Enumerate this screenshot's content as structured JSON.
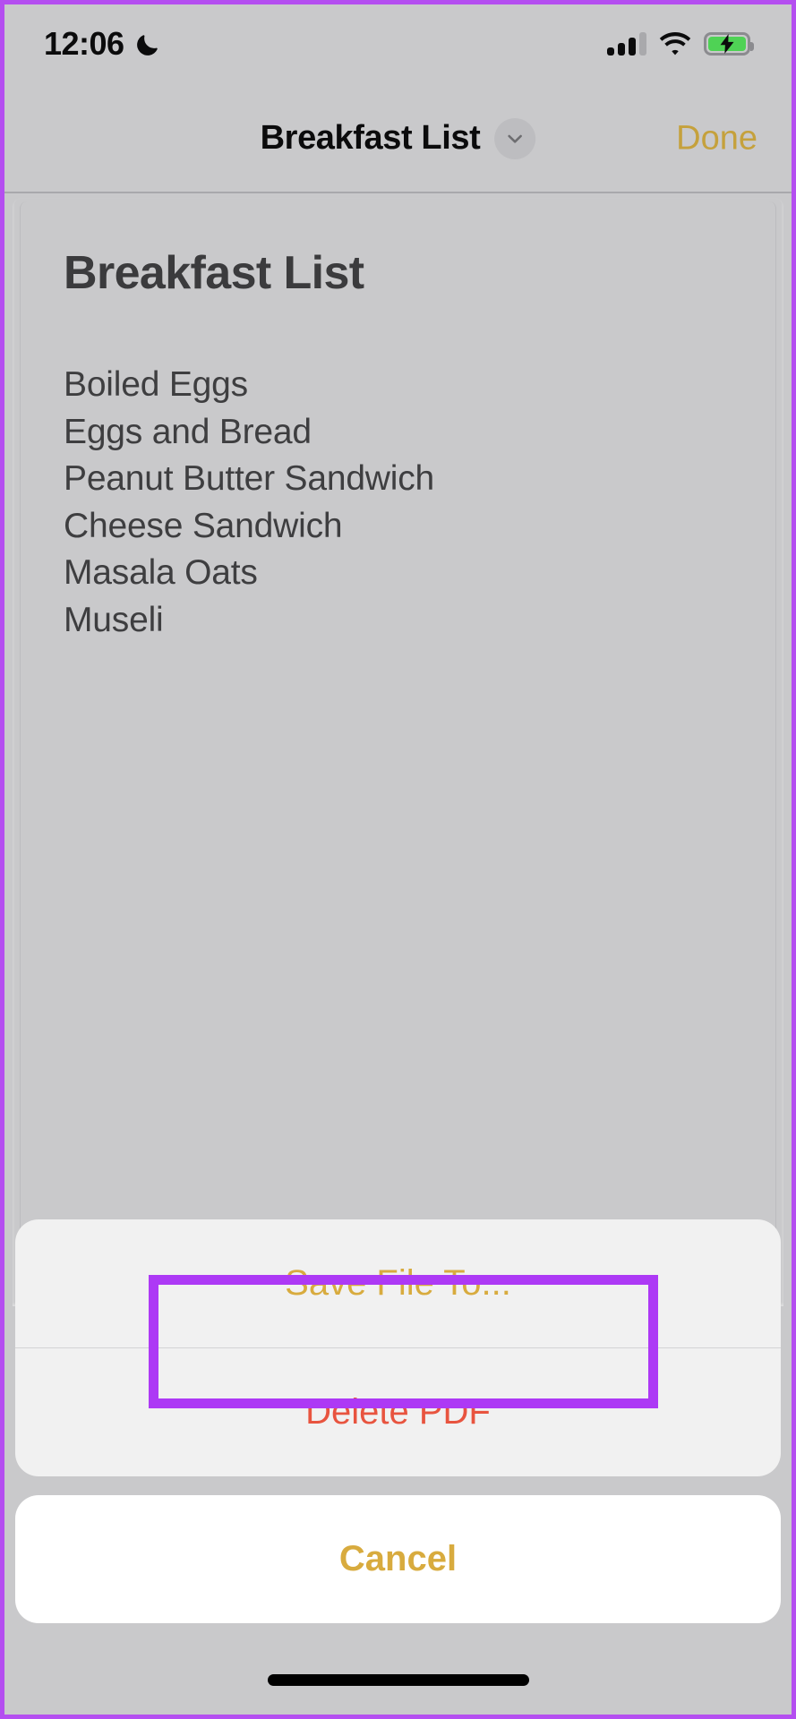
{
  "colors": {
    "accent_amber": "#d8ab3e",
    "destructive_red": "#e8543f",
    "highlight_purple": "#ad39f5",
    "screen_background": "#c9c9cb",
    "battery_green": "#4fd255"
  },
  "status_bar": {
    "time": "12:06",
    "moon_icon": "crescent-moon-icon",
    "signal_icon": "cellular-signal-icon",
    "signal_bars_filled": 3,
    "signal_bars_total": 4,
    "wifi_icon": "wifi-icon",
    "battery_icon": "battery-charging-icon",
    "battery_charging": true
  },
  "nav_bar": {
    "title": "Breakfast List",
    "chevron_icon": "chevron-down-icon",
    "done_label": "Done"
  },
  "document": {
    "heading": "Breakfast List",
    "items": [
      "Boiled Eggs",
      "Eggs and Bread",
      "Peanut Butter Sandwich",
      "Cheese Sandwich",
      "Masala Oats",
      "Museli"
    ]
  },
  "action_sheet": {
    "save_label": "Save File To...",
    "delete_label": "Delete PDF",
    "cancel_label": "Cancel"
  }
}
